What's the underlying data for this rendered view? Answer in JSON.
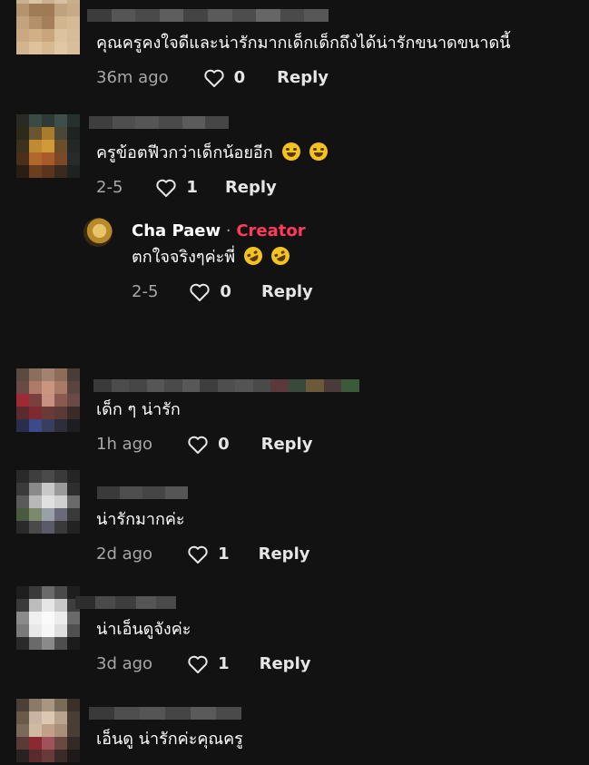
{
  "comments": [
    {
      "text": "คุณครูคงใจดีและน่ารักมากเด็กเด็กถึงได้น่ารักขนาดขนาดนี้",
      "time": "36m ago",
      "likes": "0",
      "reply": "Reply"
    },
    {
      "text": "ครูข้อตฟีวกว่าเด็กน้อยอีก",
      "time": "2-5",
      "likes": "1",
      "reply": "Reply"
    },
    {
      "author": "Cha Paew",
      "separator": "·",
      "badge": "Creator",
      "text": "ตกใจจริงๆค่ะพี่",
      "time": "2-5",
      "likes": "0",
      "reply": "Reply"
    },
    {
      "text": "เด็ก ๆ น่ารัก",
      "time": "1h ago",
      "likes": "0",
      "reply": "Reply"
    },
    {
      "text": "น่ารักมากค่ะ",
      "time": "2d ago",
      "likes": "1",
      "reply": "Reply"
    },
    {
      "text": "น่าเอ็นดูจังค่ะ",
      "time": "3d ago",
      "likes": "1",
      "reply": "Reply"
    },
    {
      "text": "เอ็นดู น่ารักค่ะคุณครู"
    }
  ],
  "icons": {
    "like": "heart-outline-icon",
    "emoji": "grinning-sweat-emoji-icon",
    "laugh": "rolling-laughing-emoji-icon"
  },
  "colors": {
    "background": "#121212",
    "creator": "#ff3b5c",
    "muted": "#a7a7a7"
  }
}
